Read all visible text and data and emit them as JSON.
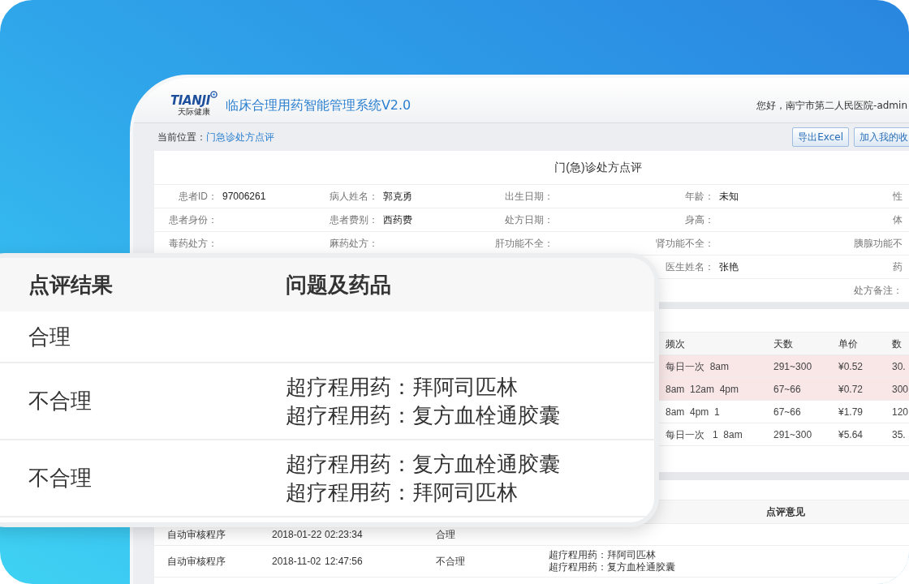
{
  "app": {
    "logo_mark": "TIANJI",
    "logo_caption": "天际健康",
    "title": "临床合理用药智能管理系统V2.0",
    "greeting": "您好，南宁市第二人民医院-admin"
  },
  "breadcrumb": {
    "label": "当前位置：",
    "current": "门急诊处方点评"
  },
  "actions": [
    "导出Excel",
    "加入我的收"
  ],
  "page_title": "门(急)诊处方点评",
  "patient_info": [
    [
      {
        "label": "患者ID：",
        "value": "97006261"
      },
      {
        "label": "病人姓名：",
        "value": "郭克勇"
      },
      {
        "label": "出生日期："
      },
      {
        "label": "年龄：",
        "value": "未知"
      },
      {
        "label": "性"
      }
    ],
    [
      {
        "label": "患者身份："
      },
      {
        "label": "患者费别：",
        "value": "西药费"
      },
      {
        "label": "处方日期："
      },
      {
        "label": "身高："
      },
      {
        "label": "体"
      }
    ],
    [
      {
        "label": "毒药处方："
      },
      {
        "label": "麻药处方："
      },
      {
        "label": "肝功能不全："
      },
      {
        "label": "肾功能不全："
      },
      {
        "label": "胰腺功能不"
      }
    ],
    [
      {
        "label": "医生姓名：",
        "value": "张艳"
      },
      {
        "label": "药"
      }
    ],
    [
      {
        "label": "处方备注："
      }
    ]
  ],
  "drug_table": {
    "columns": [
      "频次",
      "天数",
      "单价",
      "数"
    ],
    "rows": [
      {
        "flagged": true,
        "cells": [
          "每日一次  8am",
          "291~300",
          "¥0.52",
          "30."
        ]
      },
      {
        "flagged": true,
        "cells": [
          "8am  12am  4pm",
          "67~66",
          "¥0.72",
          "300"
        ]
      },
      {
        "flagged": false,
        "cells": [
          "8am  4pm  1",
          "67~66",
          "¥1.79",
          "120"
        ]
      },
      {
        "flagged": false,
        "cells": [
          "每日一次   1  8am",
          "291~300",
          "¥5.64",
          "35."
        ]
      }
    ]
  },
  "review_table": {
    "opinion_header": "点评意见",
    "rows": [
      {
        "reviewer": "自动审核程序",
        "date": "2018-01-22",
        "time": "02:23:34",
        "result": "合理",
        "opinion": []
      },
      {
        "reviewer": "自动审核程序",
        "date": "2018-11-02",
        "time": "12:47:56",
        "result": "不合理",
        "opinion": [
          "超疗程用药：拜阿司匹林",
          "超疗程用药：复方血栓通胶囊"
        ]
      }
    ]
  },
  "zoom_card": {
    "columns": [
      "点评结果",
      "问题及药品"
    ],
    "rows": [
      {
        "result": "合理",
        "issues": []
      },
      {
        "result": "不合理",
        "issues": [
          "超疗程用药：拜阿司匹林",
          "超疗程用药：复方血栓通胶囊"
        ]
      },
      {
        "result": "不合理",
        "issues": [
          "超疗程用药：复方血栓通胶囊",
          "超疗程用药：拜阿司匹林"
        ]
      }
    ]
  }
}
